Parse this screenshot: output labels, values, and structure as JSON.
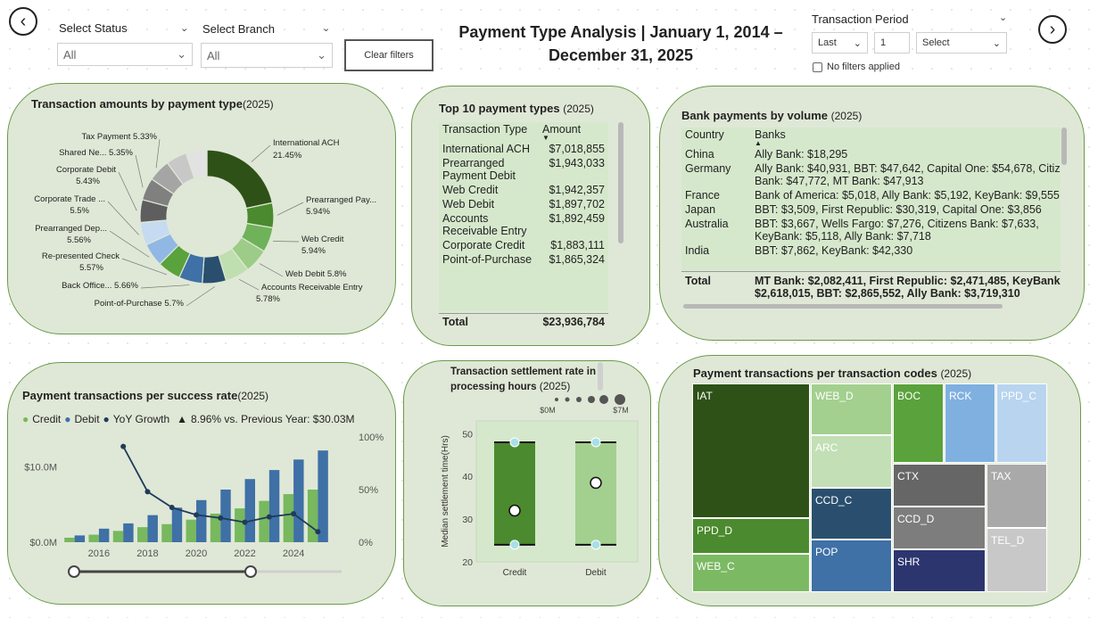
{
  "header": {
    "title_line1": "Payment Type Analysis | January 1, 2014 –",
    "title_line2": "December 31, 2025",
    "status_label": "Select Status",
    "status_value": "All",
    "branch_label": "Select Branch",
    "branch_value": "All",
    "clear_filters": "Clear filters",
    "period_label": "Transaction Period",
    "period_last": "Last",
    "period_count": "1",
    "period_unit": "Select",
    "no_filters": "No filters applied",
    "back_icon": "chevron-left-icon",
    "forward_icon": "chevron-right-icon"
  },
  "donut": {
    "title": "Transaction amounts by payment type",
    "year": "(2025)",
    "chart_data": {
      "type": "pie",
      "slices": [
        {
          "label": "International ACH",
          "value": 21.45,
          "pct": "21.45%",
          "color": "#2e5117"
        },
        {
          "label": "Prearranged Pay...",
          "value": 5.94,
          "pct": "5.94%",
          "color": "#4b8a2e"
        },
        {
          "label": "Web Credit",
          "value": 5.94,
          "pct": "5.94%",
          "color": "#6fb25a"
        },
        {
          "label": "Web Debit",
          "value": 5.8,
          "pct": "5.8%",
          "color": "#9ccc87"
        },
        {
          "label": "Accounts Receivable Entry",
          "value": 5.78,
          "pct": "5.78%",
          "color": "#c0dfb0"
        },
        {
          "label": "Point-of-Purchase",
          "value": 5.7,
          "pct": "5.7%",
          "color": "#2a4f6e"
        },
        {
          "label": "Back Office...",
          "value": 5.66,
          "pct": "5.66%",
          "color": "#3f70a6"
        },
        {
          "label": "Re-presented Check",
          "value": 5.57,
          "pct": "5.57%",
          "color": "#5aa23b"
        },
        {
          "label": "Prearranged Dep...",
          "value": 5.56,
          "pct": "5.56%",
          "color": "#91b8e4"
        },
        {
          "label": "Corporate Trade ...",
          "value": 5.5,
          "pct": "5.5%",
          "color": "#c6dbf1"
        },
        {
          "label": "Corporate Debit",
          "value": 5.43,
          "pct": "5.43%",
          "color": "#5e5e5e"
        },
        {
          "label": "Shared Ne...",
          "value": 5.35,
          "pct": "5.35%",
          "color": "#808080"
        },
        {
          "label": "Tax Payment",
          "value": 5.33,
          "pct": "5.33%",
          "color": "#a5a5a5"
        },
        {
          "label": "",
          "value": 5.0,
          "pct": "",
          "color": "#c8c8c8"
        },
        {
          "label": "",
          "value": 5.0,
          "pct": "",
          "color": "#e2e2e2"
        }
      ]
    }
  },
  "top10": {
    "title": "Top 10 payment types",
    "year": "(2025)",
    "col1": "Transaction Type",
    "col2": "Amount",
    "rows": [
      {
        "type": "International ACH",
        "amount": "$7,018,855"
      },
      {
        "type": "Prearranged Payment Debit",
        "amount": "$1,943,033"
      },
      {
        "type": "Web Credit",
        "amount": "$1,942,357"
      },
      {
        "type": "Web Debit",
        "amount": "$1,897,702"
      },
      {
        "type": "Accounts Receivable Entry",
        "amount": "$1,892,459"
      },
      {
        "type": "Corporate Credit",
        "amount": "$1,883,111"
      },
      {
        "type": "Point-of-Purchase",
        "amount": "$1,865,324"
      }
    ],
    "total_label": "Total",
    "total_value": "$23,936,784"
  },
  "banks": {
    "title": "Bank payments by volume",
    "year": "(2025)",
    "col1": "Country",
    "col2": "Banks",
    "rows": [
      {
        "country": "China",
        "banks": "Ally Bank: $18,295"
      },
      {
        "country": "Germany",
        "banks": "Ally Bank: $40,931, BBT: $47,642, Capital One: $54,678, Citizens Bank: $47,772, MT Bank: $47,913"
      },
      {
        "country": "France",
        "banks": "Bank of America: $5,018, Ally Bank: $5,192, KeyBank: $9,555"
      },
      {
        "country": "Japan",
        "banks": "BBT: $3,509, First Republic: $30,319, Capital One: $3,856"
      },
      {
        "country": "Australia",
        "banks": "BBT: $3,667, Wells Fargo: $7,276, Citizens Bank: $7,633, KeyBank: $5,118, Ally Bank: $7,718"
      },
      {
        "country": "India",
        "banks": "BBT: $7,862, KeyBank: $42,330"
      }
    ],
    "total_label": "Total",
    "total_value": "MT Bank: $2,082,411, First Republic: $2,471,485, KeyBank: $2,618,015, BBT: $2,865,552, Ally Bank: $3,719,310"
  },
  "success": {
    "title": "Payment transactions per success rate",
    "year": "(2025)",
    "legend_credit": "Credit",
    "legend_debit": "Debit",
    "legend_yoy": "YoY Growth",
    "kpi": "8.96% vs. Previous Year: $30.03M",
    "colors": {
      "credit": "#78b85e",
      "debit": "#3f70a6",
      "yoy": "#1f3b5a"
    },
    "chart_data": {
      "type": "bar",
      "x": [
        2015,
        2016,
        2017,
        2018,
        2019,
        2020,
        2021,
        2022,
        2023,
        2024,
        2025
      ],
      "x_ticks": [
        "2016",
        "2018",
        "2020",
        "2022",
        "2024"
      ],
      "y_ticks": [
        "$0.0M",
        "$10.0M"
      ],
      "y2_ticks": [
        "0%",
        "50%",
        "100%"
      ],
      "ylim": [
        0,
        14
      ],
      "y2lim": [
        0,
        1
      ],
      "series": [
        {
          "name": "Credit",
          "values": [
            0.6,
            1.0,
            1.5,
            2.0,
            2.4,
            3.0,
            3.8,
            4.5,
            5.5,
            6.4,
            7.0
          ]
        },
        {
          "name": "Debit",
          "values": [
            0.9,
            1.8,
            2.5,
            3.6,
            4.6,
            5.6,
            7.0,
            8.4,
            9.6,
            11.0,
            12.2
          ]
        },
        {
          "name": "YoY Growth",
          "values": [
            null,
            null,
            0.91,
            0.48,
            0.33,
            0.26,
            0.23,
            0.19,
            0.24,
            0.27,
            0.1
          ]
        }
      ]
    }
  },
  "settlement": {
    "title_line1": "Transaction settlement rate in",
    "title_line2": "processing hours",
    "year": "(2025)",
    "size_min": "$0M",
    "size_max": "$7M",
    "ylabel": "Median settlement time(Hrs)",
    "chart_data": {
      "type": "scatter",
      "categories": [
        "Credit",
        "Debit"
      ],
      "ylim": [
        20,
        53
      ],
      "y_ticks": [
        20,
        30,
        40,
        50
      ],
      "boxes": [
        {
          "name": "Credit",
          "min": 24,
          "max": 48,
          "median": 32,
          "color": "#4b8a2e"
        },
        {
          "name": "Debit",
          "min": 24,
          "max": 48,
          "median": 38.5,
          "color": "#a3d08f"
        }
      ]
    }
  },
  "treemap": {
    "title": "Payment transactions per transaction codes",
    "year": "(2025)",
    "chart_data": {
      "type": "heatmap",
      "cells": [
        {
          "label": "IAT",
          "color": "#2e5117"
        },
        {
          "label": "PPD_D",
          "color": "#4b8a2e"
        },
        {
          "label": "WEB_C",
          "color": "#7cb963"
        },
        {
          "label": "WEB_D",
          "color": "#a3d08f"
        },
        {
          "label": "ARC",
          "color": "#c3dfb5"
        },
        {
          "label": "CCD_C",
          "color": "#2a4f6e"
        },
        {
          "label": "POP",
          "color": "#3f70a6"
        },
        {
          "label": "BOC",
          "color": "#5aa23b"
        },
        {
          "label": "RCK",
          "color": "#7fb0e0"
        },
        {
          "label": "PPD_C",
          "color": "#b8d4ef"
        },
        {
          "label": "CTX",
          "color": "#666666"
        },
        {
          "label": "CCD_D",
          "color": "#7d7d7d"
        },
        {
          "label": "SHR",
          "color": "#2c356e"
        },
        {
          "label": "TAX",
          "color": "#a9a9a9"
        },
        {
          "label": "TEL_D",
          "color": "#c8c8c8"
        }
      ]
    }
  }
}
